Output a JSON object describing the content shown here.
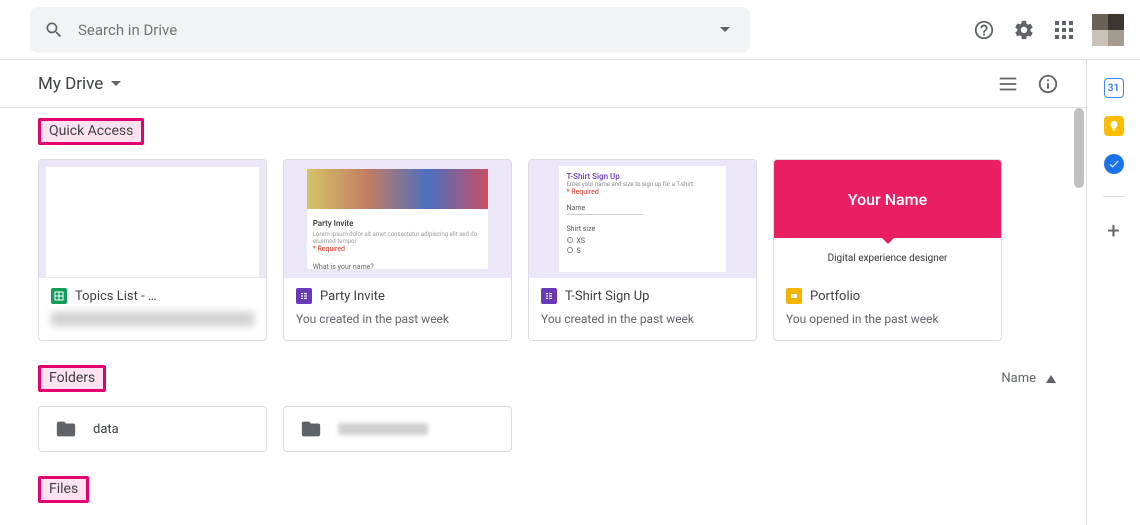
{
  "search": {
    "placeholder": "Search in Drive"
  },
  "breadcrumb": {
    "label": "My Drive"
  },
  "sections": {
    "quick": "Quick Access",
    "folders": "Folders",
    "files": "Files"
  },
  "sort": {
    "label": "Name"
  },
  "quick_access": [
    {
      "icon": "sheets",
      "title": "Topics List - ",
      "subtitle": ""
    },
    {
      "icon": "forms",
      "title": "Party Invite",
      "subtitle": "You created in the past week"
    },
    {
      "icon": "forms",
      "title": "T-Shirt Sign Up",
      "subtitle": "You created in the past week"
    },
    {
      "icon": "slides",
      "title": "Portfolio",
      "subtitle": "You opened in the past week"
    }
  ],
  "thumbs": {
    "party": {
      "title": "Party Invite",
      "question": "What is your name?",
      "required": "* Required"
    },
    "tshirt": {
      "title": "T-Shirt Sign Up",
      "desc": "Enter your name and size to sign up for a T-shirt.",
      "required": "* Required",
      "f1": "Name",
      "f2": "Shirt size",
      "o1": "XS",
      "o2": "S"
    },
    "port": {
      "name": "Your Name",
      "role": "Digital experience designer"
    }
  },
  "folders": [
    {
      "name": "data"
    },
    {
      "name": ""
    }
  ],
  "side_apps": {
    "calendar": "31"
  }
}
